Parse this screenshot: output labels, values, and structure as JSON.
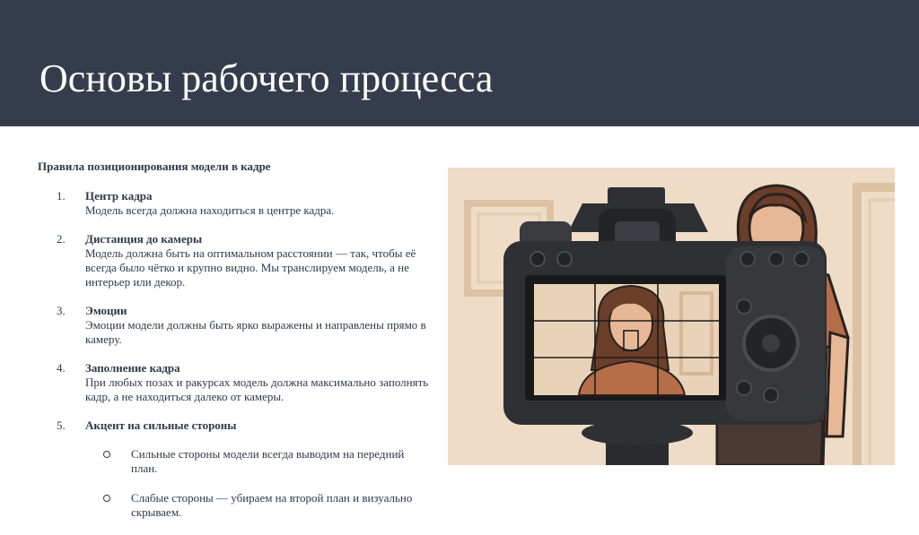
{
  "slide": {
    "title": "Основы рабочего процесса",
    "subtitle": "Правила позиционирования модели в кадре",
    "rules": [
      {
        "num": "1.",
        "heading": "Центр кадра",
        "text": "Модель всегда должна находиться в центре кадра."
      },
      {
        "num": "2.",
        "heading": "Дистанция до камеры",
        "text": "Модель должна быть на оптимальном расстоянии — так, чтобы её всегда было чётко и крупно видно. Мы транслируем модель, а не интерьер или декор."
      },
      {
        "num": "3.",
        "heading": "Эмоции",
        "text": "Эмоции модели должны быть ярко выражены и направлены прямо в камеру."
      },
      {
        "num": "4.",
        "heading": "Заполнение кадра",
        "text": "При любых позах и ракурсах модель должна максимально заполнять кадр, а не находиться далеко от камеры."
      },
      {
        "num": "5.",
        "heading": "Акцент на сильные стороны",
        "text": "",
        "subitems": [
          "Сильные стороны модели всегда выводим на передний план.",
          "Слабые стороны — убираем на второй план и визуально скрываем."
        ]
      }
    ]
  },
  "illustration": {
    "icon": "camera-viewfinder-illustration",
    "colors": {
      "wall": "#efdcc6",
      "frame": "#dcc2a3",
      "camera": "#2f3033",
      "screen": "#e9d3b8",
      "hair": "#6b3f2a",
      "skin": "#e8b896",
      "shirt": "#b56e47"
    }
  }
}
